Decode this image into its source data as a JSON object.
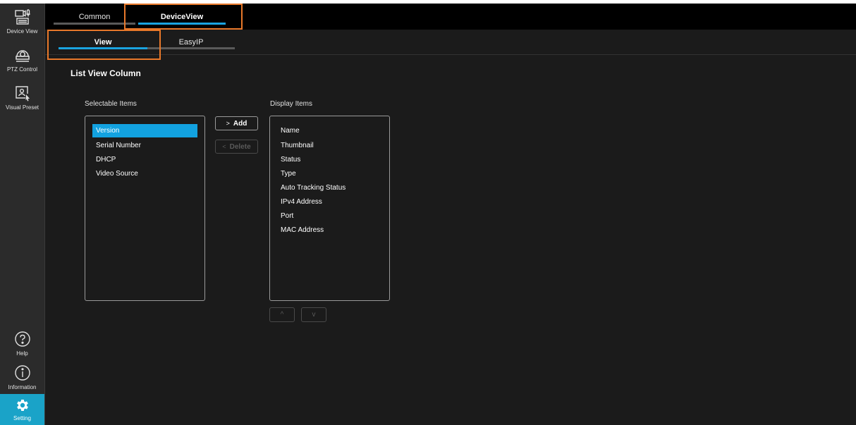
{
  "sidebar": {
    "items": [
      {
        "label": "Device View",
        "icon": "device-view-icon"
      },
      {
        "label": "PTZ Control",
        "icon": "ptz-camera-icon"
      },
      {
        "label": "Visual Preset",
        "icon": "visual-preset-icon"
      },
      {
        "label": "Help",
        "icon": "help-icon"
      },
      {
        "label": "Information",
        "icon": "information-icon"
      },
      {
        "label": "Setting",
        "icon": "gear-icon"
      }
    ]
  },
  "top_tabs": [
    {
      "label": "Common"
    },
    {
      "label": "DeviceView"
    }
  ],
  "sub_tabs": [
    {
      "label": "View"
    },
    {
      "label": "EasyIP"
    }
  ],
  "section_title": "List View Column",
  "selectable": {
    "label": "Selectable Items",
    "items": [
      "Version",
      "Serial Number",
      "DHCP",
      "Video Source"
    ]
  },
  "display": {
    "label": "Display Items",
    "items": [
      "Name",
      "Thumbnail",
      "Status",
      "Type",
      "Auto Tracking Status",
      "IPv4 Address",
      "Port",
      "MAC Address"
    ]
  },
  "buttons": {
    "add": "Add",
    "delete": "Delete",
    "add_glyph": ">",
    "delete_glyph": "<",
    "up_glyph": "^",
    "down_glyph": "v"
  },
  "colors": {
    "accent": "#1aa3e0",
    "highlight": "#e8782a",
    "selection": "#12a2e0"
  }
}
